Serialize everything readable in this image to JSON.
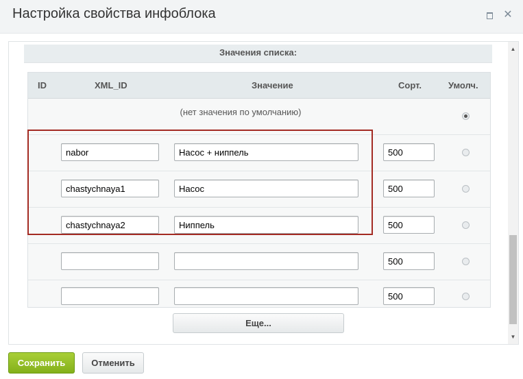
{
  "window": {
    "title": "Настройка свойства инфоблока"
  },
  "section": {
    "title": "Значения списка:"
  },
  "table": {
    "headers": {
      "id": "ID",
      "xml_id": "XML_ID",
      "value": "Значение",
      "sort": "Сорт.",
      "default": "Умолч."
    },
    "no_default_label": "(нет значения по умолчанию)",
    "rows": [
      {
        "xml_id": "nabor",
        "value": "Насос + ниппель",
        "sort": "500",
        "default": false
      },
      {
        "xml_id": "chastychnaya1",
        "value": "Насос",
        "sort": "500",
        "default": false
      },
      {
        "xml_id": "chastychnaya2",
        "value": "Ниппель",
        "sort": "500",
        "default": false
      },
      {
        "xml_id": "",
        "value": "",
        "sort": "500",
        "default": false
      },
      {
        "xml_id": "",
        "value": "",
        "sort": "500",
        "default": false
      }
    ],
    "more_label": "Еще..."
  },
  "footer": {
    "save_label": "Сохранить",
    "cancel_label": "Отменить"
  },
  "colors": {
    "highlight": "#a32a22",
    "save_button": "#8dbb22"
  },
  "icons": {
    "maximize": "maximize-icon",
    "close": "close-icon"
  }
}
